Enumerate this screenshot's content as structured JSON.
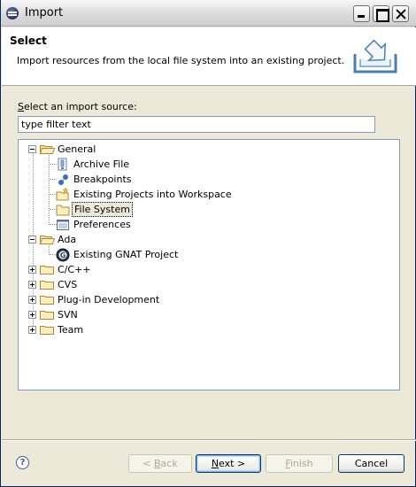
{
  "window": {
    "title": "Import"
  },
  "header": {
    "title": "Select",
    "description": "Import resources from the local file system into an existing project."
  },
  "source": {
    "label_mnemonic": "S",
    "label_rest": "elect an import source:",
    "filter_value": "type filter text"
  },
  "tree": {
    "general": {
      "label": "General",
      "children": [
        "Archive File",
        "Breakpoints",
        "Existing Projects into Workspace",
        "File System",
        "Preferences"
      ]
    },
    "ada": {
      "label": "Ada",
      "children": [
        "Existing GNAT Project"
      ]
    },
    "collapsed": [
      "C/C++",
      "CVS",
      "Plug-in Development",
      "SVN",
      "Team"
    ],
    "selected": "File System"
  },
  "buttons": {
    "back_pre": "< ",
    "back_mnemonic": "B",
    "back_rest": "ack",
    "next_mnemonic": "N",
    "next_rest": "ext >",
    "finish_mnemonic": "F",
    "finish_rest": "inish",
    "cancel": "Cancel",
    "help": "?"
  }
}
